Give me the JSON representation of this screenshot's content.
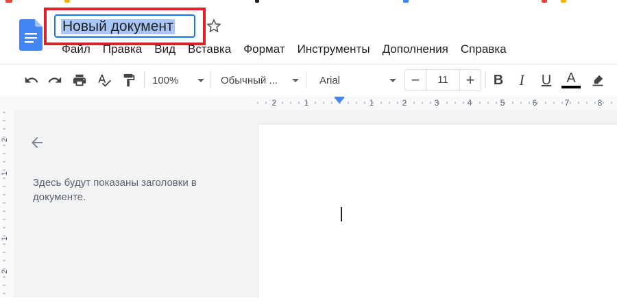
{
  "document": {
    "title": "Новый документ"
  },
  "menu": [
    "Файл",
    "Правка",
    "Вид",
    "Вставка",
    "Формат",
    "Инструменты",
    "Дополнения",
    "Справка"
  ],
  "toolbar": {
    "zoom": "100%",
    "style": "Обычный ...",
    "font": "Arial",
    "font_size": "11",
    "minus": "−",
    "plus": "+",
    "bold": "B",
    "italic": "I",
    "underline": "U",
    "text_color": "A"
  },
  "ruler": {
    "labels": [
      "2",
      "1",
      "1",
      "2",
      "3",
      "4",
      "5",
      "6",
      "7",
      "8"
    ]
  },
  "vertical_ruler": {
    "labels": [
      "2",
      "1",
      "1",
      "2"
    ]
  },
  "outline": {
    "empty_text": "Здесь будут показаны заголовки в документе."
  },
  "colors": {
    "accent": "#1a73e8",
    "highlight_box": "#d9232a",
    "selection": "#a9c7f5"
  }
}
